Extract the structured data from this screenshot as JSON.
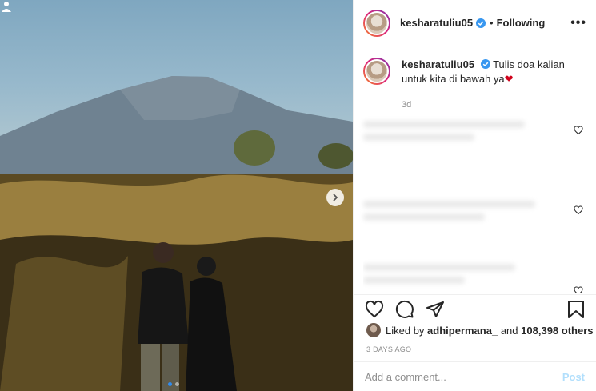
{
  "post": {
    "username": "kesharatuliu05",
    "following_label": "Following",
    "separator": "•",
    "more_label": "•••"
  },
  "caption": {
    "username": "kesharatuliu05",
    "text": "Tulis doa kalian untuk kita di bawah ya",
    "emoji": "❤",
    "time_ago": "3d"
  },
  "likes": {
    "prefix": "Liked by",
    "user": "adhipermana_",
    "and": "and",
    "count": "108,398 others"
  },
  "date_label": "3 DAYS AGO",
  "comment_box": {
    "placeholder": "Add a comment...",
    "post_label": "Post"
  },
  "carousel": {
    "slide_count": 2,
    "active_index": 0
  },
  "colors": {
    "verified": "#3897f0",
    "post_disabled": "#b2dffc",
    "heart": "#d0021b",
    "dot_active": "#2f8cf0"
  },
  "icons": [
    "chevron-right-icon",
    "user-tag-icon",
    "verified-icon",
    "heart-icon",
    "comment-icon",
    "share-icon",
    "bookmark-icon"
  ]
}
